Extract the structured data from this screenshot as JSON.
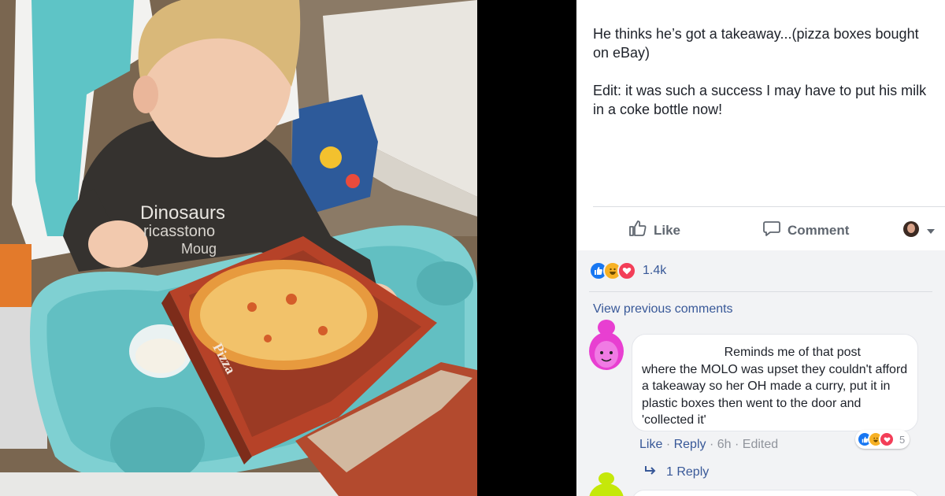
{
  "post": {
    "paragraphs": [
      "He thinks he’s got a takeaway...(pizza boxes bought on eBay)",
      "Edit: it was such a success I may have to put his milk in a coke bottle now!"
    ]
  },
  "photo": {
    "shirt_line1": "Dinosaurs",
    "shirt_line2": "ricasstono",
    "shirt_line3": "Moug",
    "box_label": "Pizza"
  },
  "actions": {
    "like_label": "Like",
    "comment_label": "Comment"
  },
  "reactions": {
    "count": "1.4k",
    "icons": [
      "like-icon",
      "haha-icon",
      "love-icon"
    ]
  },
  "comments": {
    "view_previous": "View previous comments",
    "items": [
      {
        "text_line1": "Reminds me of that post",
        "text_rest": "where the MOLO was upset they couldn't afford a takeaway so her OH made a curry, put it in plastic boxes then went to the door and 'collected it'",
        "reaction_count": "5",
        "like_label": "Like",
        "reply_label": "Reply",
        "time": "6h",
        "edited": "Edited",
        "replies_label": "1 Reply"
      }
    ]
  },
  "colors": {
    "link": "#385898",
    "like_blue": "#1877f2",
    "love_red": "#f33e58",
    "haha_yellow": "#f7b125",
    "avatar1": "#e83fd1",
    "avatar2": "#c5e80a"
  }
}
